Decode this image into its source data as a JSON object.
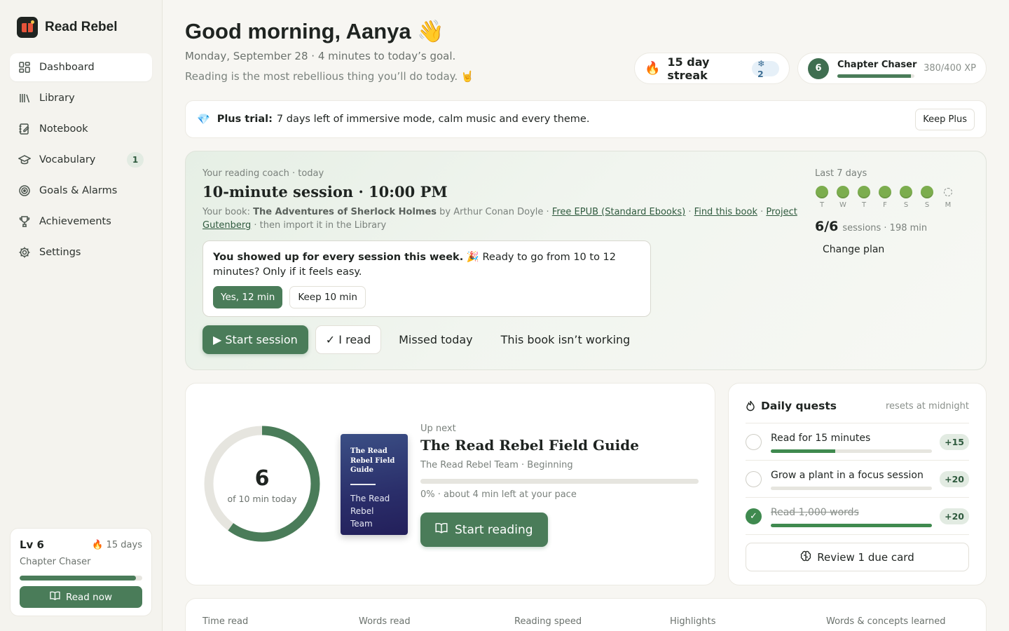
{
  "brand": {
    "name": "Read Rebel"
  },
  "nav": [
    {
      "label": "Dashboard",
      "icon": "dashboard-icon",
      "active": true
    },
    {
      "label": "Library",
      "icon": "library-icon"
    },
    {
      "label": "Notebook",
      "icon": "notebook-icon"
    },
    {
      "label": "Vocabulary",
      "icon": "graduation-cap-icon",
      "badge": "1"
    },
    {
      "label": "Goals & Alarms",
      "icon": "target-icon"
    },
    {
      "label": "Achievements",
      "icon": "trophy-icon"
    },
    {
      "label": "Settings",
      "icon": "gear-icon"
    }
  ],
  "side_card": {
    "level": "Lv 6",
    "streak": "🔥 15 days",
    "title": "Chapter Chaser",
    "progress": 0.95,
    "button": "Read now"
  },
  "header": {
    "greeting": "Good morning, Aanya 👋",
    "subline": "Monday, September 28 · 4 minutes to today’s goal.",
    "tagline": "Reading is the most rebellious thing you’ll do today. 🤘"
  },
  "streak_pill": {
    "icon": "🔥",
    "text": "15 day streak",
    "freezes": "❄ 2"
  },
  "level_pill": {
    "level": "6",
    "name": "Chapter Chaser",
    "xp": "380/400 XP",
    "progress": 0.95
  },
  "trial": {
    "icon": "💎",
    "bold": "Plus trial:",
    "text": "7 days left of immersive mode, calm music and every theme.",
    "button": "Keep Plus"
  },
  "coach": {
    "eyebrow": "Your reading coach · today",
    "title": "10-minute session · 10:00 PM",
    "book_prefix": "Your book:",
    "book_title": "The Adventures of Sherlock Holmes",
    "book_by": "by Arthur Conan Doyle ·",
    "link_epub": "Free EPUB (Standard Ebooks)",
    "link_find": "Find this book",
    "link_gutenberg": "Project Gutenberg",
    "book_suffix": "· then import it in the Library",
    "nudge_bold": "You showed up for every session this week.",
    "nudge_text": "🎉 Ready to go from 10 to 12 minutes? Only if it feels easy.",
    "nudge_yes": "Yes, 12 min",
    "nudge_keep": "Keep 10 min",
    "start": "▶ Start session",
    "iread": "✓ I read",
    "missed": "Missed today",
    "notworking": "This book isn’t working",
    "week_label": "Last 7 days",
    "days": [
      {
        "l": "T",
        "done": true
      },
      {
        "l": "W",
        "done": true
      },
      {
        "l": "T",
        "done": true
      },
      {
        "l": "F",
        "done": true
      },
      {
        "l": "S",
        "done": true
      },
      {
        "l": "S",
        "done": true
      },
      {
        "l": "M",
        "done": false
      }
    ],
    "sessions_count": "6/6",
    "sessions_text": "sessions · 198 min",
    "change_plan": "Change plan"
  },
  "today": {
    "minutes": "6",
    "goal_text": "of 10 min today",
    "progress": 0.6,
    "cover_title": "The Read Rebel Field Guide",
    "cover_author": "The Read Rebel Team",
    "up_next": "Up next",
    "book_title": "The Read Rebel Field Guide",
    "book_meta": "The Read Rebel Team · Beginning",
    "book_progress": 0,
    "book_progress_text": "0% · about 4 min left at your pace",
    "button": "Start reading"
  },
  "quests": {
    "title": "Daily quests",
    "reset": "resets at midnight",
    "items": [
      {
        "label": "Read for 15 minutes",
        "xp": "+15",
        "progress": 0.4,
        "done": false
      },
      {
        "label": "Grow a plant in a focus session",
        "xp": "+20",
        "progress": 0,
        "done": false
      },
      {
        "label": "Read 1,000 words",
        "xp": "+20",
        "progress": 1,
        "done": true
      }
    ],
    "review": "Review 1 due card"
  },
  "stats": [
    "Time read",
    "Words read",
    "Reading speed",
    "Highlights",
    "Words & concepts learned"
  ],
  "colors": {
    "accent": "#4a7c59",
    "leaf": "#7cad4e",
    "ring_track": "#e6e5df"
  }
}
